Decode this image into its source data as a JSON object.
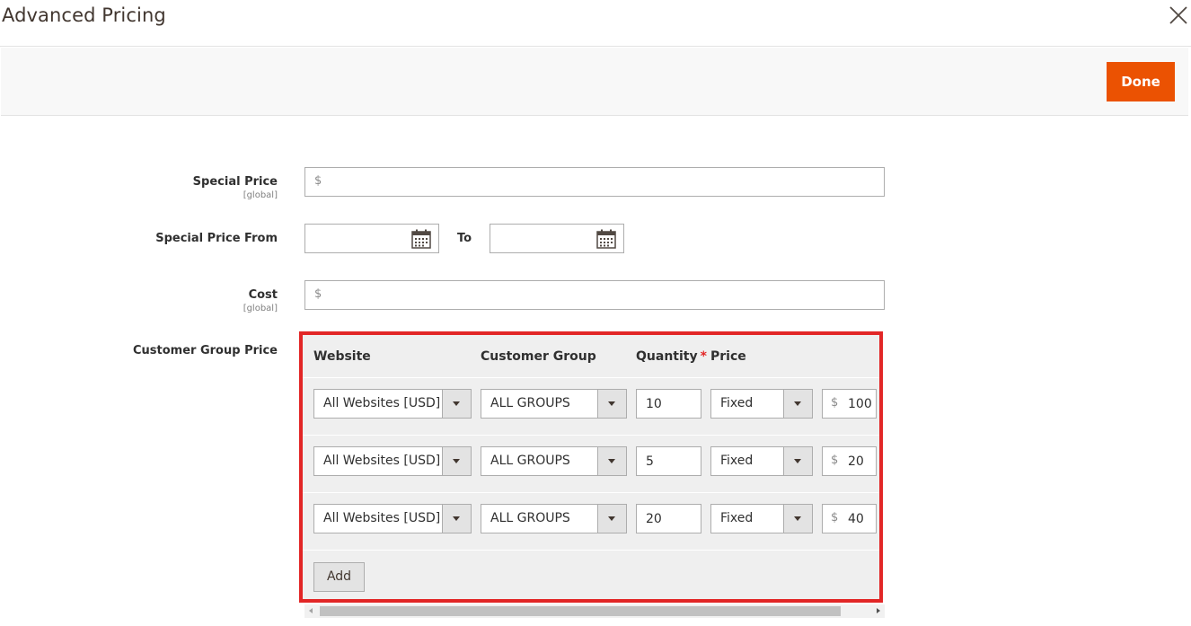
{
  "modal": {
    "title": "Advanced Pricing",
    "done_label": "Done"
  },
  "form": {
    "special_price": {
      "label": "Special Price",
      "scope": "[global]",
      "currency": "$",
      "value": ""
    },
    "special_price_from": {
      "label": "Special Price From",
      "to_label": "To",
      "from_value": "",
      "to_value": ""
    },
    "cost": {
      "label": "Cost",
      "scope": "[global]",
      "currency": "$",
      "value": ""
    },
    "customer_group_price": {
      "label": "Customer Group Price",
      "columns": {
        "website": "Website",
        "customer_group": "Customer Group",
        "quantity": "Quantity",
        "required_mark": "*",
        "price": "Price"
      },
      "rows": [
        {
          "website": "All Websites [USD]",
          "group": "ALL GROUPS",
          "qty": "10",
          "price_type": "Fixed",
          "currency": "$",
          "price": "100"
        },
        {
          "website": "All Websites [USD]",
          "group": "ALL GROUPS",
          "qty": "5",
          "price_type": "Fixed",
          "currency": "$",
          "price": "20"
        },
        {
          "website": "All Websites [USD]",
          "group": "ALL GROUPS",
          "qty": "20",
          "price_type": "Fixed",
          "currency": "$",
          "price": "40"
        }
      ],
      "add_label": "Add"
    }
  },
  "colors": {
    "accent": "#eb5202",
    "highlight_border": "#e22626",
    "required": "#e22626"
  }
}
